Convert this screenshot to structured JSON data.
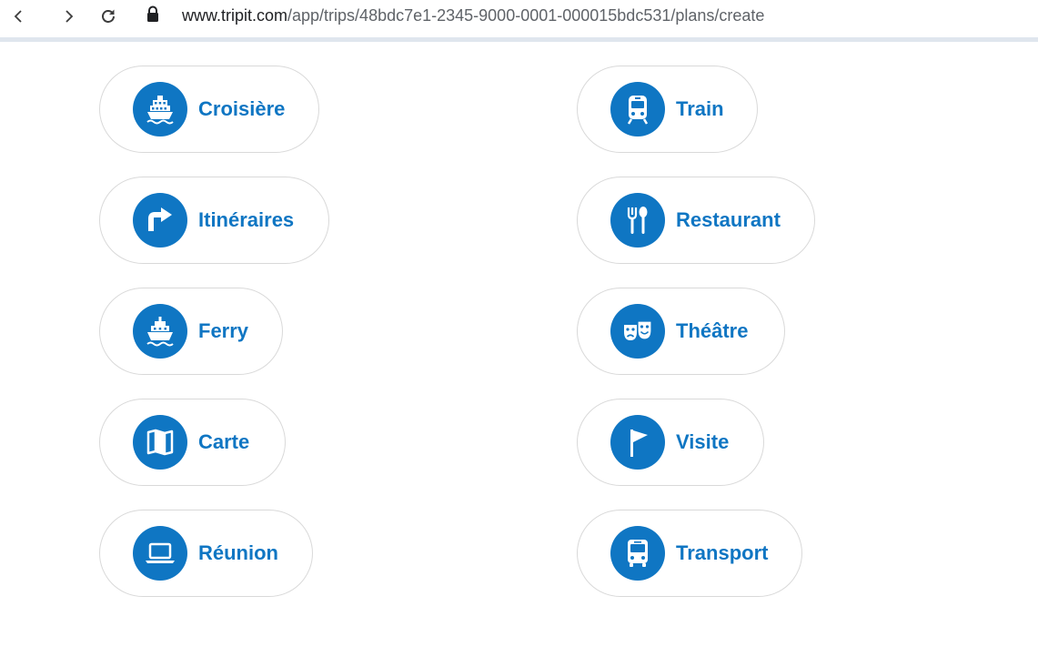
{
  "browser": {
    "url_host": "www.tripit.com",
    "url_path": "/app/trips/48bdc7e1-2345-9000-0001-000015bdc531/plans/create"
  },
  "plans": {
    "left": [
      {
        "label": "Croisière",
        "icon": "cruise-ship-icon"
      },
      {
        "label": "Itinéraires",
        "icon": "directions-arrow-icon"
      },
      {
        "label": "Ferry",
        "icon": "ferry-icon"
      },
      {
        "label": "Carte",
        "icon": "map-icon"
      },
      {
        "label": "Réunion",
        "icon": "laptop-icon"
      }
    ],
    "right": [
      {
        "label": "Train",
        "icon": "train-icon"
      },
      {
        "label": "Restaurant",
        "icon": "fork-spoon-icon"
      },
      {
        "label": "Théâtre",
        "icon": "theater-masks-icon"
      },
      {
        "label": "Visite",
        "icon": "flag-icon"
      },
      {
        "label": "Transport",
        "icon": "bus-icon"
      }
    ]
  },
  "colors": {
    "accent": "#0f76c3",
    "pill_border": "#d9d9d9"
  }
}
